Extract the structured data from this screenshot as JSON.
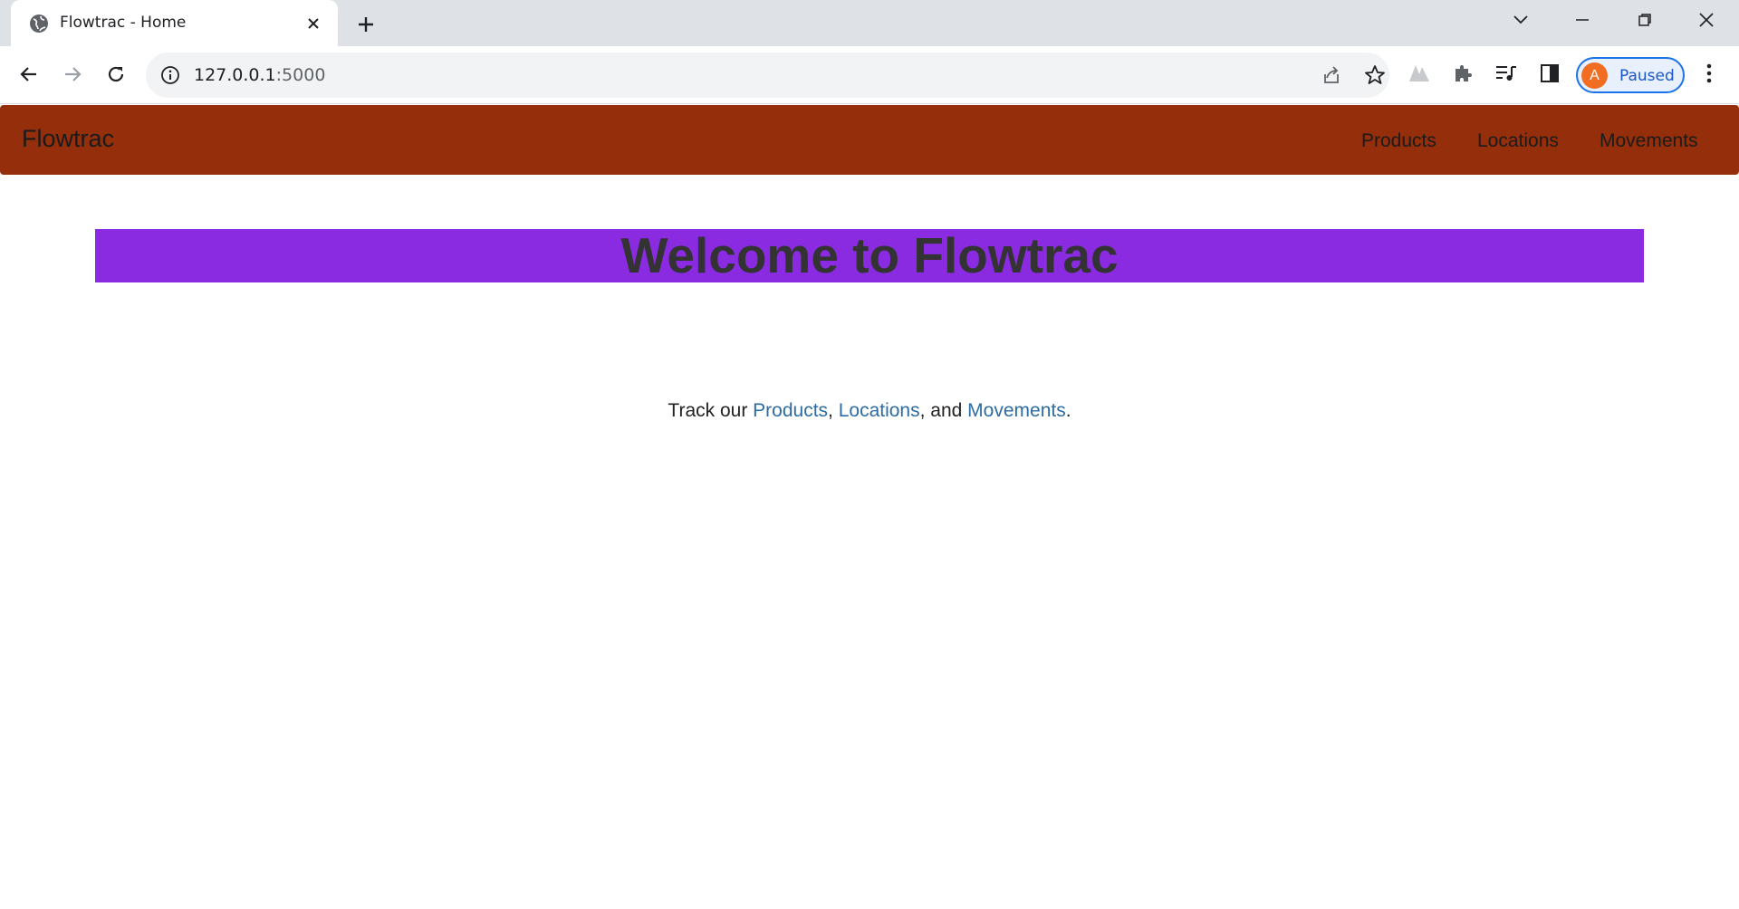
{
  "browser": {
    "tab_title": "Flowtrac - Home",
    "url_host": "127.0.0.1",
    "url_port": ":5000",
    "profile_initial": "A",
    "profile_status": "Paused"
  },
  "navbar": {
    "brand": "Flowtrac",
    "links": [
      "Products",
      "Locations",
      "Movements"
    ],
    "background": "#942e0b"
  },
  "hero": {
    "title": "Welcome to Flowtrac",
    "background": "#8a2be2"
  },
  "tagline": {
    "prefix": "Track our ",
    "link1": "Products",
    "sep1": ", ",
    "link2": "Locations",
    "sep2": ", and ",
    "link3": "Movements",
    "suffix": ".",
    "link_color": "#2d6ca2"
  }
}
